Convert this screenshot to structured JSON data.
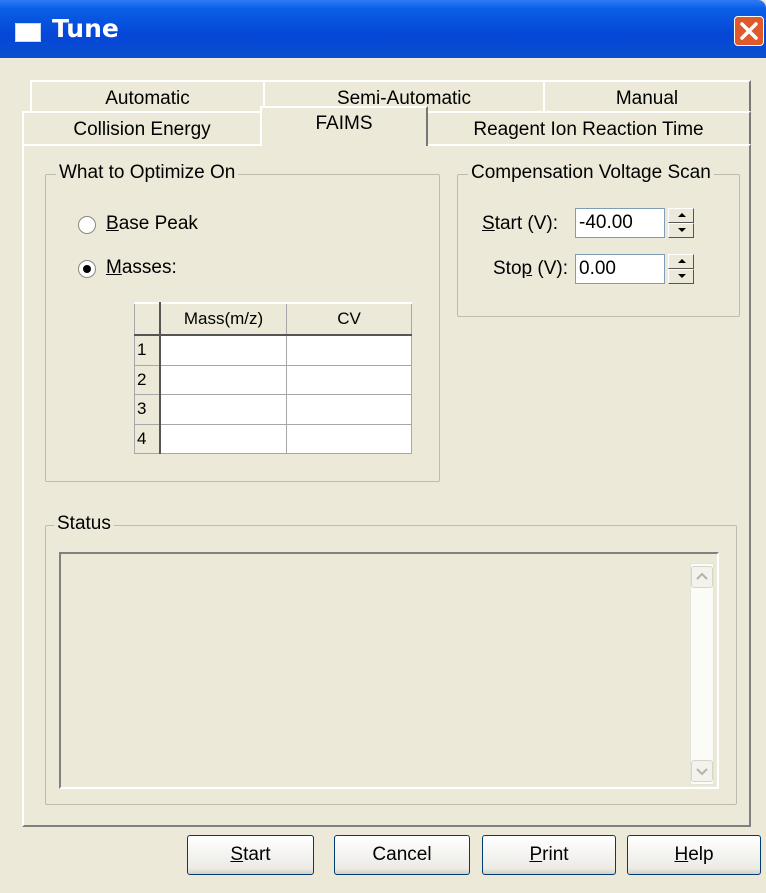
{
  "window": {
    "title": "Tune"
  },
  "tabs": {
    "row1": [
      {
        "label": "Automatic"
      },
      {
        "label": "Semi-Automatic"
      },
      {
        "label": "Manual"
      }
    ],
    "row2": [
      {
        "label": "Collision Energy"
      },
      {
        "label": "FAIMS",
        "active": true
      },
      {
        "label": "Reagent Ion Reaction Time"
      }
    ]
  },
  "optimize": {
    "group_label": "What to Optimize On",
    "base_peak": {
      "label_first": "B",
      "label_rest": "ase Peak",
      "selected": false
    },
    "masses": {
      "label_first": "M",
      "label_rest": "asses:",
      "selected": true
    },
    "table": {
      "headers": [
        "Mass(m/z)",
        "CV"
      ],
      "rows": [
        {
          "index": "1",
          "mass": "",
          "cv": ""
        },
        {
          "index": "2",
          "mass": "",
          "cv": ""
        },
        {
          "index": "3",
          "mass": "",
          "cv": ""
        },
        {
          "index": "4",
          "mass": "",
          "cv": ""
        }
      ]
    }
  },
  "cv_scan": {
    "group_label": "Compensation Voltage Scan",
    "start": {
      "label_first": "S",
      "label_rest": "tart (V):",
      "value": "-40.00"
    },
    "stop": {
      "label_before": "Sto",
      "label_acc": "p",
      "label_after": " (V):",
      "value": "0.00"
    }
  },
  "status": {
    "group_label": "Status",
    "text": ""
  },
  "buttons": {
    "start": {
      "acc": "S",
      "rest": "tart"
    },
    "cancel": {
      "label": "Cancel"
    },
    "print": {
      "acc": "P",
      "rest": "rint"
    },
    "help": {
      "acc": "H",
      "rest": "elp"
    }
  }
}
